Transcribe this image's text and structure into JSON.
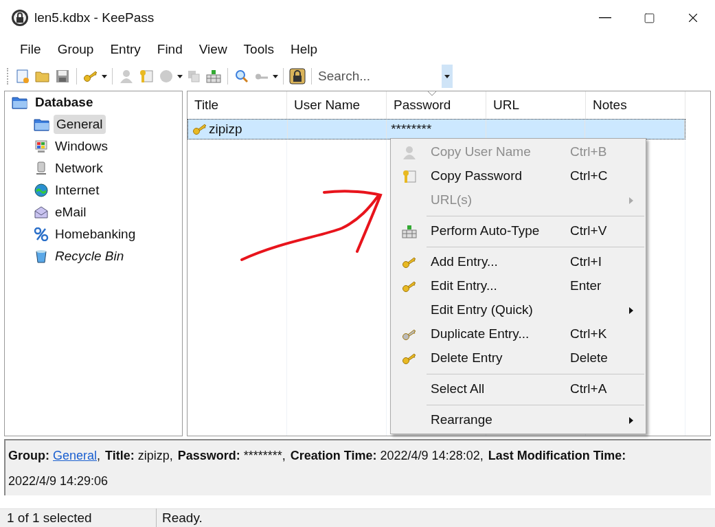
{
  "window": {
    "title": "len5.kdbx - KeePass"
  },
  "menu_bar": [
    "File",
    "Group",
    "Entry",
    "Find",
    "View",
    "Tools",
    "Help"
  ],
  "search": {
    "placeholder": "Search..."
  },
  "groups": [
    {
      "label": "Database",
      "selected": false,
      "italic": false,
      "children": [
        {
          "label": "General",
          "selected": true,
          "italic": false
        },
        {
          "label": "Windows",
          "selected": false,
          "italic": false
        },
        {
          "label": "Network",
          "selected": false,
          "italic": false
        },
        {
          "label": "Internet",
          "selected": false,
          "italic": false
        },
        {
          "label": "eMail",
          "selected": false,
          "italic": false
        },
        {
          "label": "Homebanking",
          "selected": false,
          "italic": false
        },
        {
          "label": "Recycle Bin",
          "selected": false,
          "italic": true
        }
      ]
    }
  ],
  "table": {
    "columns": [
      {
        "label": "Title",
        "sorted": false
      },
      {
        "label": "User Name",
        "sorted": false
      },
      {
        "label": "Password",
        "sorted": true
      },
      {
        "label": "URL",
        "sorted": false
      },
      {
        "label": "Notes",
        "sorted": false
      }
    ],
    "rows": [
      {
        "selected": true,
        "cells": [
          "zipizp",
          "",
          "********",
          "",
          ""
        ]
      }
    ]
  },
  "context_menu": [
    {
      "kind": "item",
      "label": "Copy User Name",
      "shortcut": "Ctrl+B",
      "disabled": true,
      "submenu": false
    },
    {
      "kind": "item",
      "label": "Copy Password",
      "shortcut": "Ctrl+C",
      "disabled": false,
      "submenu": false
    },
    {
      "kind": "item",
      "label": "URL(s)",
      "disabled": true,
      "submenu": true
    },
    {
      "kind": "separator"
    },
    {
      "kind": "item",
      "label": "Perform Auto-Type",
      "shortcut": "Ctrl+V",
      "disabled": false,
      "submenu": false
    },
    {
      "kind": "separator"
    },
    {
      "kind": "item",
      "label": "Add Entry...",
      "shortcut": "Ctrl+I",
      "disabled": false,
      "submenu": false
    },
    {
      "kind": "item",
      "label": "Edit Entry...",
      "shortcut": "Enter",
      "disabled": false,
      "submenu": false
    },
    {
      "kind": "item",
      "label": "Edit Entry (Quick)",
      "disabled": false,
      "submenu": true
    },
    {
      "kind": "item",
      "label": "Duplicate Entry...",
      "shortcut": "Ctrl+K",
      "disabled": false,
      "submenu": false
    },
    {
      "kind": "item",
      "label": "Delete Entry",
      "shortcut": "Delete",
      "disabled": false,
      "submenu": false
    },
    {
      "kind": "separator"
    },
    {
      "kind": "item",
      "label": "Select All",
      "shortcut": "Ctrl+A",
      "disabled": false,
      "submenu": false
    },
    {
      "kind": "separator"
    },
    {
      "kind": "item",
      "label": "Rearrange",
      "disabled": false,
      "submenu": true
    }
  ],
  "details": {
    "lines": [
      [
        {
          "kind": "link",
          "label": "Group:",
          "value": "General",
          "after": ","
        },
        {
          "kind": "text",
          "label": "Title:",
          "value": "zipizp,"
        },
        {
          "kind": "text",
          "label": "Password:",
          "value": "********,"
        },
        {
          "kind": "text",
          "label": "Creation Time:",
          "value": "2022/4/9 14:28:02,"
        },
        {
          "kind": "label",
          "label": "Last Modification Time:"
        }
      ],
      [
        {
          "kind": "value",
          "value": "2022/4/9 14:29:06"
        }
      ]
    ]
  },
  "status_bar": [
    "1 of 1 selected",
    "Ready."
  ]
}
